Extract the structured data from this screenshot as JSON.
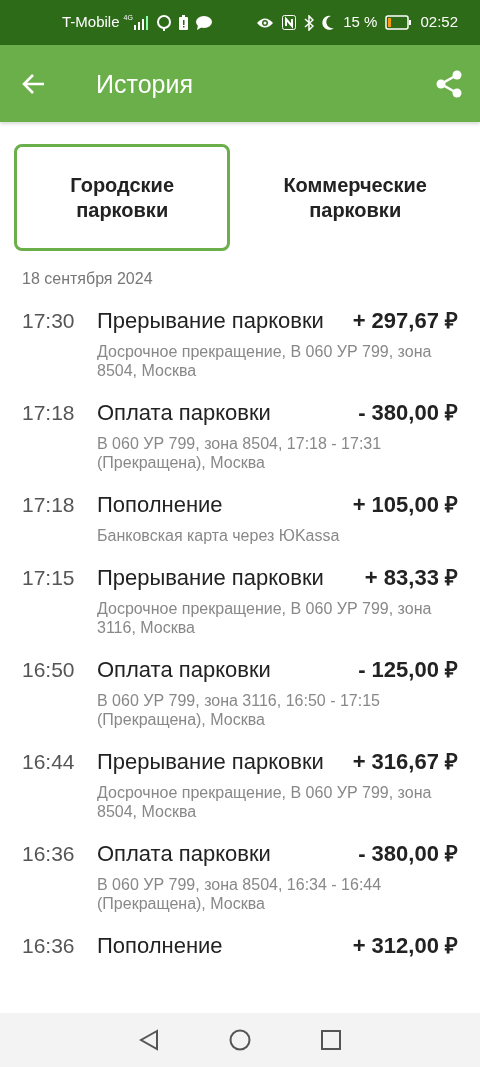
{
  "status_bar": {
    "carrier": "T-Mobile",
    "network": "4G",
    "battery": "15 %",
    "time": "02:52"
  },
  "header": {
    "title": "История"
  },
  "tabs": [
    {
      "label": "Городские парковки",
      "selected": true
    },
    {
      "label": "Коммерческие парковки",
      "selected": false
    }
  ],
  "date": "18 сентября 2024",
  "transactions": [
    {
      "time": "17:30",
      "title": "Прерывание парковки",
      "amount": "+ 297,67 ₽",
      "details": "Досрочное прекращение, В 060 УР 799, зона 8504, Москва"
    },
    {
      "time": "17:18",
      "title": "Оплата парковки",
      "amount": "- 380,00 ₽",
      "details": "В 060 УР 799, зона 8504, 17:18 - 17:31 (Прекращена), Москва"
    },
    {
      "time": "17:18",
      "title": "Пополнение",
      "amount": "+ 105,00 ₽",
      "details": "Банковская карта через ЮKassa"
    },
    {
      "time": "17:15",
      "title": "Прерывание парковки",
      "amount": "+ 83,33 ₽",
      "details": "Досрочное прекращение, В 060 УР 799, зона 3116, Москва"
    },
    {
      "time": "16:50",
      "title": "Оплата парковки",
      "amount": "- 125,00 ₽",
      "details": "В 060 УР 799, зона 3116, 16:50 - 17:15 (Прекращена), Москва"
    },
    {
      "time": "16:44",
      "title": "Прерывание парковки",
      "amount": "+ 316,67 ₽",
      "details": "Досрочное прекращение, В 060 УР 799, зона 8504, Москва"
    },
    {
      "time": "16:36",
      "title": "Оплата парковки",
      "amount": "- 380,00 ₽",
      "details": "В 060 УР 799, зона 8504, 16:34 - 16:44 (Прекращена), Москва"
    },
    {
      "time": "16:36",
      "title": "Пополнение",
      "amount": "+ 312,00 ₽"
    }
  ]
}
